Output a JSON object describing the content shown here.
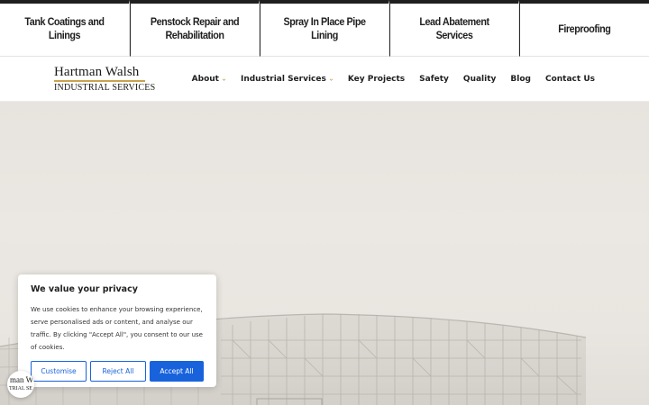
{
  "service_bar": [
    {
      "label": "Tank Coatings and Linings"
    },
    {
      "label": "Penstock Repair and Rehabilitation"
    },
    {
      "label": "Spray In Place Pipe Lining"
    },
    {
      "label": "Lead Abatement Services"
    },
    {
      "label": "Fireproofing"
    }
  ],
  "logo": {
    "name": "Hartman Walsh",
    "tagline": "INDUSTRIAL SERVICES"
  },
  "nav": [
    {
      "label": "About",
      "has_dropdown": true
    },
    {
      "label": "Industrial Services",
      "has_dropdown": true
    },
    {
      "label": "Key Projects",
      "has_dropdown": false
    },
    {
      "label": "Safety",
      "has_dropdown": false
    },
    {
      "label": "Quality",
      "has_dropdown": false
    },
    {
      "label": "Blog",
      "has_dropdown": false
    },
    {
      "label": "Contact Us",
      "has_dropdown": false
    }
  ],
  "cookie": {
    "title": "We value your privacy",
    "text": "We use cookies to enhance your browsing experience, serve personalised ads or content, and analyse our traffic. By clicking \"Accept All\", you consent to our use of cookies.",
    "customise": "Customise",
    "reject": "Reject All",
    "accept": "Accept All"
  },
  "revisit_badge": {
    "line1": "man W",
    "line2": "TRIAL SE"
  },
  "colors": {
    "accent_gold": "#c9a24d",
    "cookie_blue": "#1863dc",
    "dark": "#1f1f1f"
  },
  "icons": {
    "nav_caret": "chevron-down-icon"
  }
}
